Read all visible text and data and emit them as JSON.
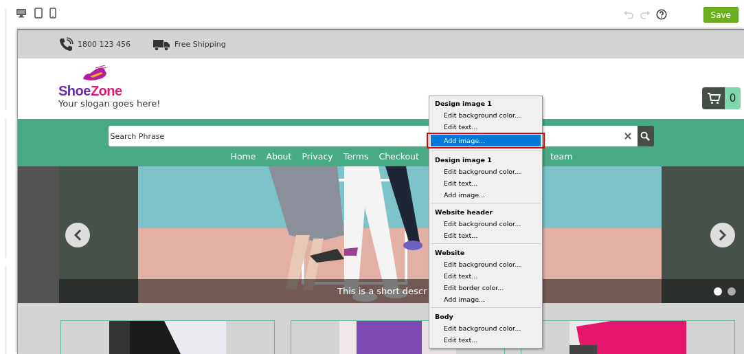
{
  "toolbar": {
    "devices": [
      {
        "kind": "desktop"
      },
      {
        "kind": "tablet"
      },
      {
        "kind": "phone"
      }
    ],
    "undo": {
      "disabled": true
    },
    "redo": {
      "disabled": true
    },
    "save_button": "Save"
  },
  "site": {
    "topbar": [
      {
        "kind": "phone",
        "text": "1800 123 456"
      },
      {
        "kind": "truck",
        "text": "Free Shipping"
      }
    ],
    "logo": {
      "part_1": "Shoe",
      "part_2": "Zone",
      "slogan": "Your slogan goes here!"
    },
    "cart_count": "0",
    "search": {
      "placeholder": "Search Phrase"
    },
    "nav": [
      "Home",
      "About",
      "Privacy",
      "Terms",
      "Checkout",
      "team"
    ],
    "slider": {
      "caption": "This is a short descr",
      "dots": [
        {
          "selected": true
        },
        {
          "selected": false
        }
      ]
    }
  },
  "context_menu": [
    {
      "title": "Design image 1",
      "items": [
        {
          "label": "Edit background color...",
          "selected": false
        },
        {
          "label": "Edit text...",
          "selected": false
        },
        {
          "label": "Add image...",
          "selected": true
        }
      ]
    },
    {
      "title": "Design image 1",
      "items": [
        {
          "label": "Edit background color...",
          "selected": false
        },
        {
          "label": "Edit text...",
          "selected": false
        },
        {
          "label": "Add image...",
          "selected": false
        }
      ]
    },
    {
      "title": "Website header",
      "items": [
        {
          "label": "Edit background color...",
          "selected": false
        },
        {
          "label": "Edit text...",
          "selected": false
        }
      ]
    },
    {
      "title": "Website",
      "items": [
        {
          "label": "Edit background color...",
          "selected": false
        },
        {
          "label": "Edit text...",
          "selected": false
        },
        {
          "label": "Edit border color...",
          "selected": false
        },
        {
          "label": "Add image...",
          "selected": false
        }
      ]
    },
    {
      "title": "Body",
      "items": [
        {
          "label": "Edit background color...",
          "selected": false
        },
        {
          "label": "Edit text...",
          "selected": false
        }
      ]
    }
  ]
}
